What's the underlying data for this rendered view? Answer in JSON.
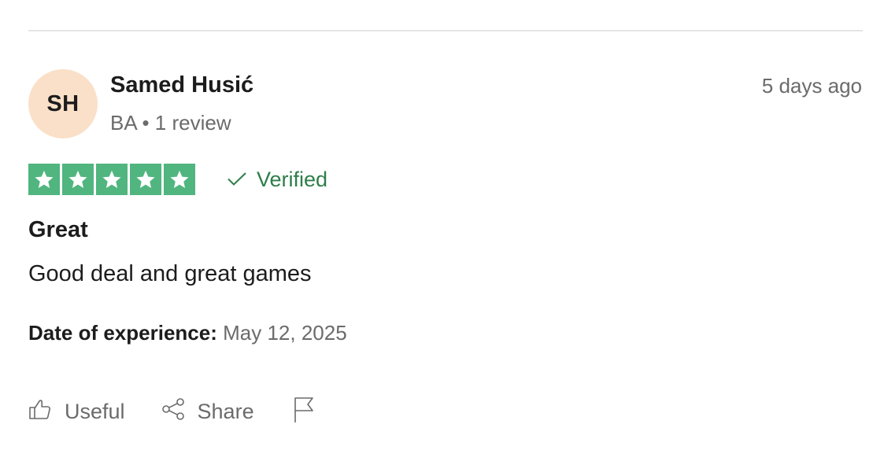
{
  "reviewer": {
    "initials": "SH",
    "name": "Samed Husić",
    "meta": "BA • 1 review",
    "posted": "5 days ago"
  },
  "rating": {
    "stars": 5,
    "max": 5,
    "verified_label": "Verified"
  },
  "review": {
    "title": "Great",
    "body": "Good deal and great games"
  },
  "experience": {
    "label": "Date of experience:",
    "date": "May 12, 2025"
  },
  "actions": {
    "useful": "Useful",
    "share": "Share"
  },
  "colors": {
    "star_green": "#51b57f",
    "verified_green": "#2d7e4a",
    "avatar_bg": "#fae0c8",
    "muted_text": "#6b6b6b"
  },
  "icons": [
    "star-icon",
    "check-icon",
    "thumbs-up-icon",
    "share-icon",
    "flag-icon"
  ]
}
